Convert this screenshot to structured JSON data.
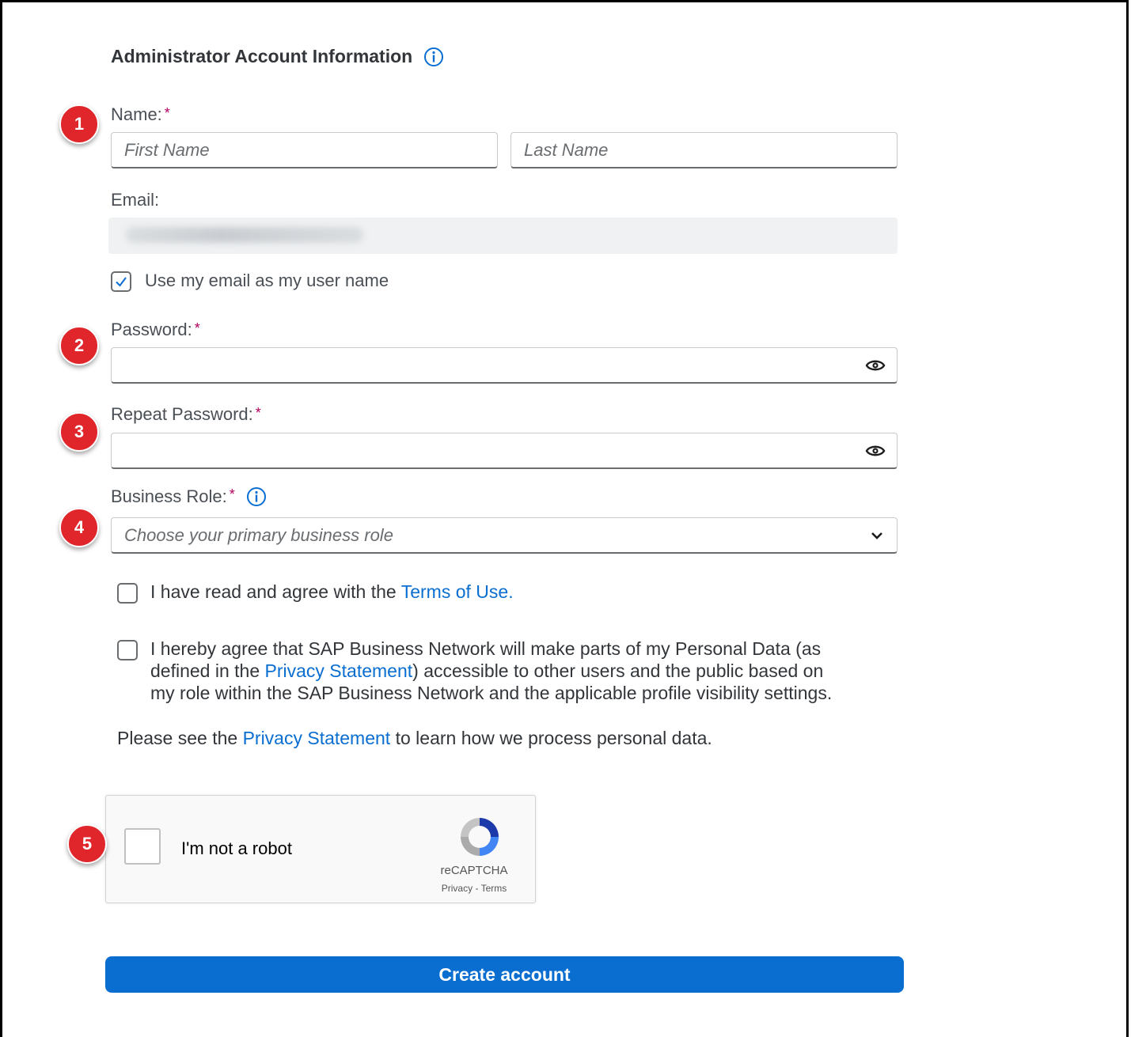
{
  "section": {
    "title": "Administrator Account Information"
  },
  "name_field": {
    "label": "Name:",
    "required_mark": "*",
    "first_placeholder": "First Name",
    "last_placeholder": "Last Name"
  },
  "email_field": {
    "label": "Email:",
    "value": ""
  },
  "use_email_checkbox": {
    "label": "Use my email as my user name",
    "checked": true
  },
  "password_field": {
    "label": "Password:",
    "required_mark": "*"
  },
  "repeat_password_field": {
    "label": "Repeat Password:",
    "required_mark": "*"
  },
  "business_role_field": {
    "label": "Business Role:",
    "required_mark": "*",
    "placeholder": "Choose your primary business role"
  },
  "terms": {
    "prefix": "I have read and agree with the ",
    "link": "Terms of Use",
    "suffix": "."
  },
  "personal_data": {
    "line1": "I hereby agree that SAP Business Network will make parts of my Personal Data (as",
    "line2_prefix": "defined in the ",
    "line2_link": "Privacy Statement",
    "line2_suffix": ") accessible to other users and the public based on",
    "line3": "my role within the SAP Business Network and the applicable profile visibility settings."
  },
  "privacy_note": {
    "prefix": "Please see the ",
    "link": "Privacy Statement",
    "suffix": " to learn how we process personal data."
  },
  "captcha": {
    "label": "I'm not a robot",
    "brand": "reCAPTCHA",
    "privacy": "Privacy",
    "separator": " - ",
    "terms": "Terms"
  },
  "create_button": {
    "label": "Create account"
  },
  "step_badges": [
    "1",
    "2",
    "3",
    "4",
    "5"
  ],
  "colors": {
    "accent": "#0a6ed1",
    "badge": "#e0262b",
    "required": "#b00060"
  }
}
